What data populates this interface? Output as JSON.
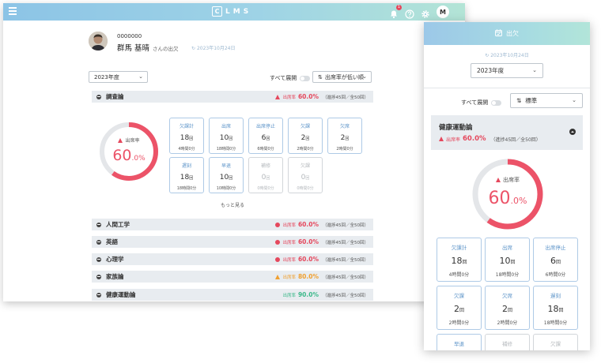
{
  "app": {
    "title": "LMS",
    "logo_letter": "C",
    "notification_count": "1",
    "avatar_letter": "M"
  },
  "student": {
    "id": "0000000",
    "name": "群馬 基晴",
    "suffix": "さんの出欠",
    "updated": "2023年10月24日"
  },
  "filters": {
    "year": "2023年度",
    "expand_all": "すべて展開",
    "sort": "出席率が低い順"
  },
  "open_course": {
    "name": "調査論",
    "rate_label": "出席率",
    "rate_value": "60.0%",
    "rate_pct": 60,
    "counts": "（進捗45回／全50回）",
    "gauge_label": "出席率",
    "gauge_int": "60",
    "gauge_dec": ".0%",
    "cells": [
      {
        "title": "欠課計",
        "num": "18",
        "unit": "回",
        "sub": "4時間0分"
      },
      {
        "title": "出席",
        "num": "10",
        "unit": "回",
        "sub": "18時間0分"
      },
      {
        "title": "出席停止",
        "num": "6",
        "unit": "回",
        "sub": "6時間0分"
      },
      {
        "title": "欠課",
        "num": "2",
        "unit": "回",
        "sub": "2時間0分"
      },
      {
        "title": "欠席",
        "num": "2",
        "unit": "回",
        "sub": "2時間0分"
      },
      {
        "title": "遅刻",
        "num": "18",
        "unit": "回",
        "sub": "18時間0分"
      },
      {
        "title": "早退",
        "num": "10",
        "unit": "回",
        "sub": "10時間0分"
      },
      {
        "title": "補修",
        "num": "0",
        "unit": "回",
        "sub": "0時間0分"
      },
      {
        "title": "欠課",
        "num": "0",
        "unit": "回",
        "sub": "0時間0分"
      }
    ],
    "more": "もっと見る"
  },
  "courses": [
    {
      "name": "人間工学",
      "rate_label": "出席率",
      "rate": "60.0%",
      "counts": "（進捗45回／全50回）",
      "color": "#e5485d"
    },
    {
      "name": "英語",
      "rate_label": "出席率",
      "rate": "60.0%",
      "counts": "（進捗45回／全50回）",
      "color": "#e5485d"
    },
    {
      "name": "心理学",
      "rate_label": "出席率",
      "rate": "60.0%",
      "counts": "（進捗45回／全50回）",
      "color": "#e5485d"
    },
    {
      "name": "家族論",
      "rate_label": "出席率",
      "rate": "80.0%",
      "counts": "（進捗45回／全50回）",
      "color": "#f0a030"
    },
    {
      "name": "健康運動論",
      "rate_label": "出席率",
      "rate": "90.0%",
      "counts": "（進捗45回／全50回）",
      "color": "#3cb88a"
    }
  ],
  "mobile": {
    "header": "出欠",
    "updated": "2023年10月24日",
    "year": "2023年度",
    "expand_all": "すべて展開",
    "sort": "標準",
    "course": {
      "name": "健康運動論",
      "rate_label": "出席率",
      "rate_value": "60.0%",
      "counts": "（進捗45回／全50回）",
      "gauge_label": "出席率",
      "gauge_int": "60",
      "gauge_dec": ".0%",
      "cells": [
        {
          "title": "欠課計",
          "num": "18",
          "unit": "回",
          "sub": "4時間0分"
        },
        {
          "title": "出席",
          "num": "10",
          "unit": "回",
          "sub": "18時間0分"
        },
        {
          "title": "出席停止",
          "num": "6",
          "unit": "回",
          "sub": "6時間0分"
        },
        {
          "title": "欠課",
          "num": "2",
          "unit": "回",
          "sub": "2時間0分"
        },
        {
          "title": "欠席",
          "num": "2",
          "unit": "回",
          "sub": "2時間0分"
        },
        {
          "title": "遅刻",
          "num": "18",
          "unit": "回",
          "sub": "18時間0分"
        },
        {
          "title": "早退"
        },
        {
          "title": "補修"
        },
        {
          "title": "欠課"
        }
      ]
    }
  }
}
